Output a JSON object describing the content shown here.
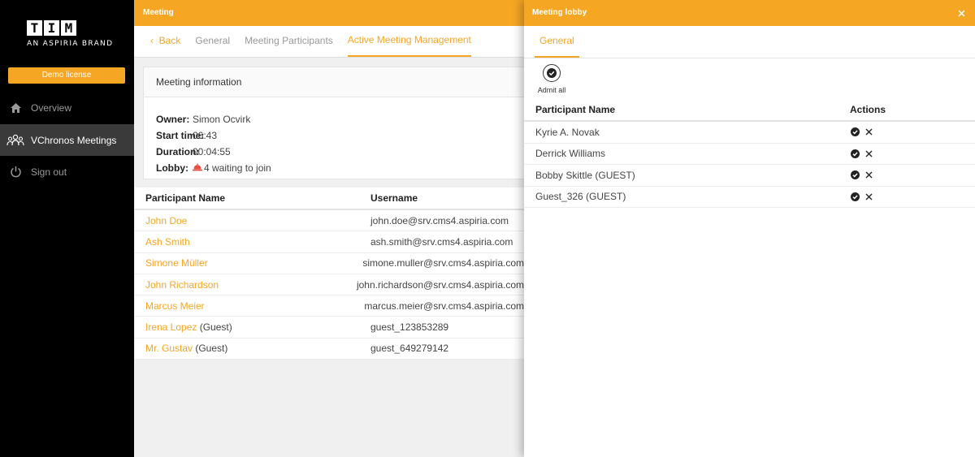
{
  "brand": {
    "letters": [
      "T",
      "I",
      "M"
    ],
    "subtitle": "AN ASPIRIA BRAND"
  },
  "sidebar": {
    "demo_label": "Demo license",
    "items": [
      {
        "label": "Overview",
        "icon": "home-icon"
      },
      {
        "label": "VChronos Meetings",
        "icon": "people-icon"
      },
      {
        "label": "Sign out",
        "icon": "power-icon"
      }
    ]
  },
  "main": {
    "header": "Meeting",
    "tabs": {
      "back": "Back",
      "general": "General",
      "participants": "Meeting Participants",
      "active": "Active Meeting Management"
    },
    "info": {
      "title": "Meeting information",
      "owner_label": "Owner:",
      "owner": "Simon Ocvirk",
      "start_label": "Start time:",
      "start": "06:43",
      "duration_label": "Duration:",
      "duration": "00:04:55",
      "lobby_label": "Lobby:",
      "lobby": "4 waiting to join"
    },
    "table": {
      "headers": [
        "Participant Name",
        "Username"
      ],
      "rows": [
        {
          "name": "John Doe",
          "suffix": "",
          "username": "john.doe@srv.cms4.aspiria.com"
        },
        {
          "name": "Ash Smith",
          "suffix": "",
          "username": "ash.smith@srv.cms4.aspiria.com"
        },
        {
          "name": "Simone Müller",
          "suffix": "",
          "username": "simone.muller@srv.cms4.aspiria.com"
        },
        {
          "name": "John Richardson",
          "suffix": "",
          "username": "john.richardson@srv.cms4.aspiria.com"
        },
        {
          "name": "Marcus Meier",
          "suffix": "",
          "username": "marcus.meier@srv.cms4.aspiria.com"
        },
        {
          "name": "Irena Lopez",
          "suffix": " (Guest)",
          "username": "guest_123853289"
        },
        {
          "name": "Mr. Gustav",
          "suffix": " (Guest)",
          "username": "guest_649279142"
        }
      ]
    }
  },
  "lobby": {
    "header": "Meeting lobby",
    "tab": "General",
    "admit_all": "Admit all",
    "headers": [
      "Participant Name",
      "Actions"
    ],
    "rows": [
      {
        "name": "Kyrie A. Novak"
      },
      {
        "name": "Derrick Williams"
      },
      {
        "name": "Bobby Skittle (GUEST)"
      },
      {
        "name": "Guest_326 (GUEST)"
      }
    ]
  },
  "colors": {
    "accent": "#f5a623",
    "sidebar_bg": "#000000",
    "lobby_alert": "#e74c3c"
  }
}
